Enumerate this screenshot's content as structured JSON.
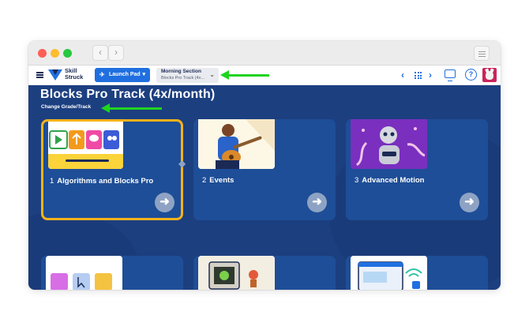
{
  "appbar": {
    "logo_text": "Skill Struck",
    "launch_label": "Launch Pad",
    "section_title": "Morning Section",
    "section_subtitle": "Blocks Pro Track (4x..."
  },
  "main": {
    "title": "Blocks Pro Track (4x/month)",
    "change_link": "Change Grade/Track",
    "cards": [
      {
        "number": "1",
        "title": "Algorithms and Blocks Pro",
        "selected": true
      },
      {
        "number": "2",
        "title": "Events",
        "selected": false
      },
      {
        "number": "3",
        "title": "Advanced Motion",
        "selected": false
      }
    ]
  },
  "icons": {
    "nav_back": "chevron-left-icon",
    "nav_forward": "chevron-right-icon",
    "menu": "hamburger-icon",
    "launch": "rocket-icon",
    "grid": "grid-icon",
    "present": "presentation-icon",
    "help": "question-icon",
    "card_go": "arrow-right-icon"
  },
  "colors": {
    "main_bg": "#1c3f80",
    "card_bg": "#1e4e97",
    "selected_border": "#f7b21a",
    "accent": "#1f6fe0",
    "annotation_arrow": "#1fd41f"
  }
}
